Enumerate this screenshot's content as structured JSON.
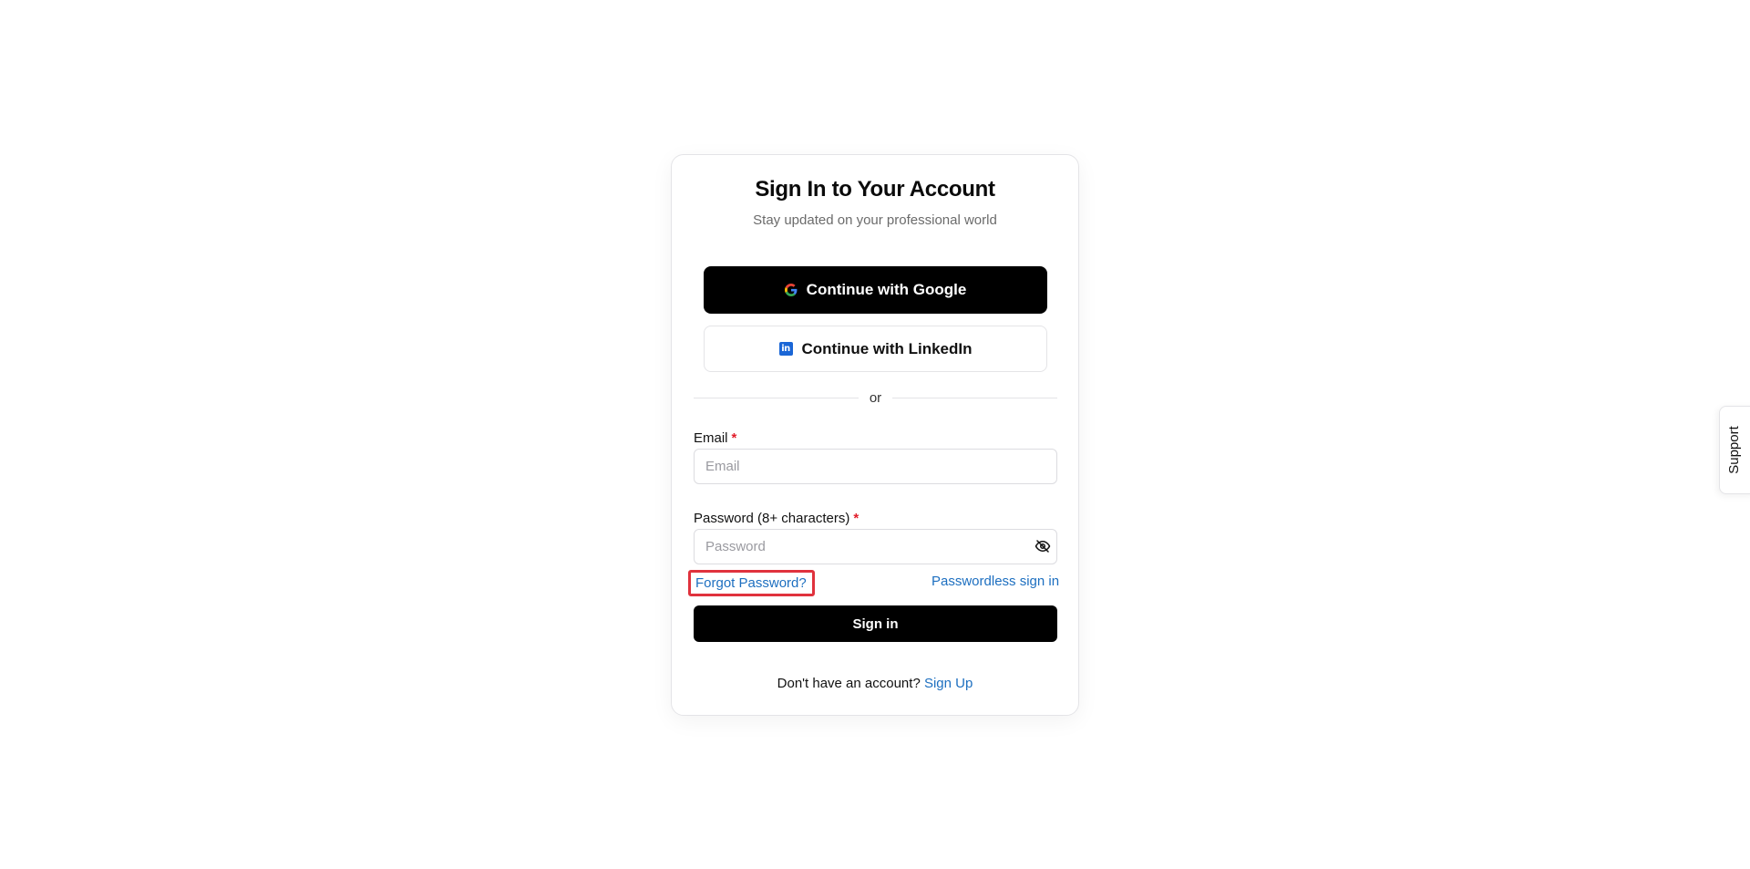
{
  "signin_card": {
    "title": "Sign In to Your Account",
    "subtitle": "Stay updated on your professional world",
    "google_button": {
      "label": "Continue with Google",
      "icon": "google-icon"
    },
    "linkedin_button": {
      "label": "Continue with LinkedIn",
      "icon": "linkedin-icon",
      "icon_text": "in"
    },
    "divider_text": "or",
    "email": {
      "label": "Email",
      "required_mark": "*",
      "placeholder": "Email",
      "value": ""
    },
    "password": {
      "label": "Password (8+ characters)",
      "required_mark": "*",
      "placeholder": "Password",
      "value": "",
      "toggle_icon": "eye-slash-icon"
    },
    "forgot_password_link": "Forgot Password?",
    "passwordless_link": "Passwordless sign in",
    "signin_button": "Sign in",
    "signup_prompt": "Don't have an account?",
    "signup_link": "Sign Up"
  },
  "support_tab": {
    "label": "Support"
  },
  "colors": {
    "primary_button": "#000000",
    "link": "#1d6fc0",
    "required": "#e11d2a",
    "highlight_border": "#e0323d",
    "linkedin_brand": "#1a66d6"
  }
}
